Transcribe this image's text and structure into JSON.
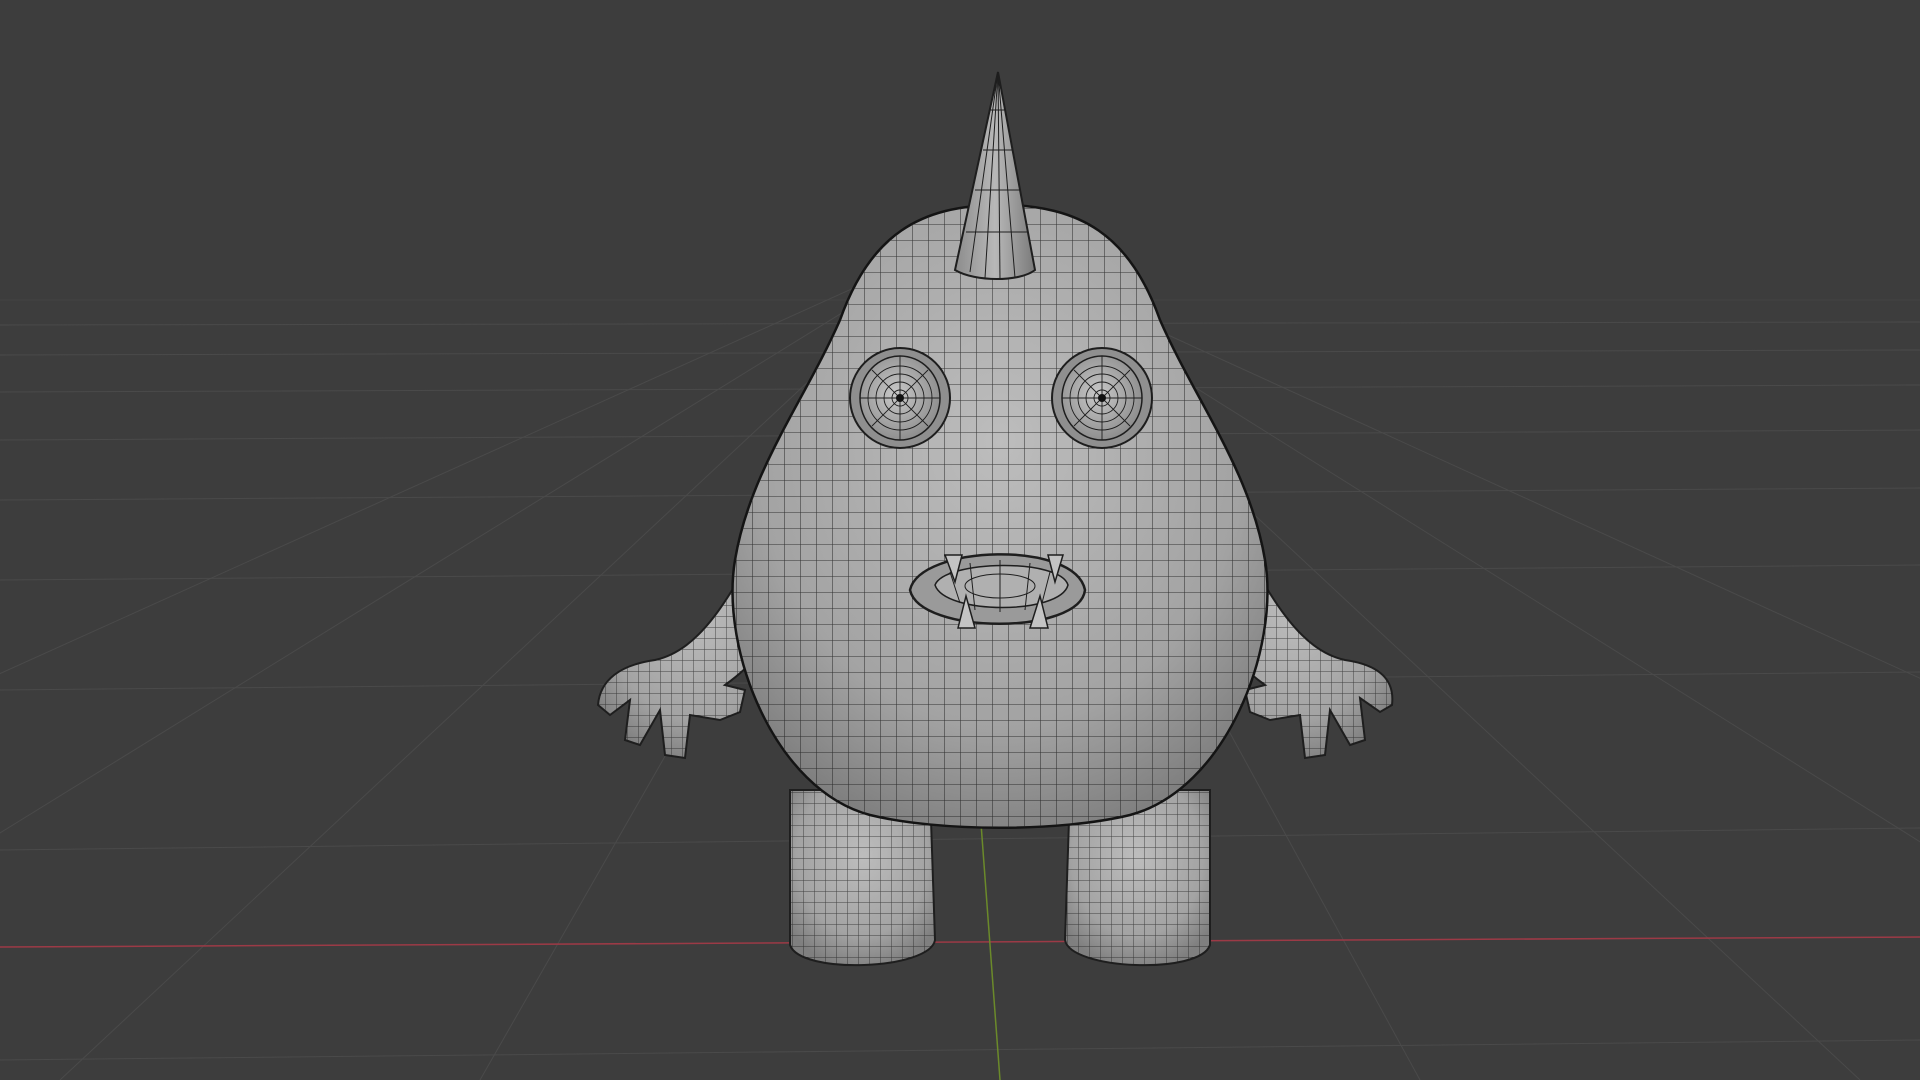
{
  "viewport": {
    "mode": "3d-viewport",
    "shading": "solid",
    "wireframe_overlay": true,
    "background_color": "#3d3d3d",
    "grid_color": "#4a4a4a",
    "x_axis_color": "#9c3a46",
    "y_axis_color": "#6b8a2a",
    "mesh_color": "#a9a9a9",
    "wire_color": "#1e1e1e"
  },
  "object": {
    "name_icon": "monster-mesh",
    "features": [
      "horn",
      "eye-left",
      "eye-right",
      "mouth",
      "teeth",
      "arm-left",
      "arm-right",
      "leg-left",
      "leg-right"
    ]
  }
}
